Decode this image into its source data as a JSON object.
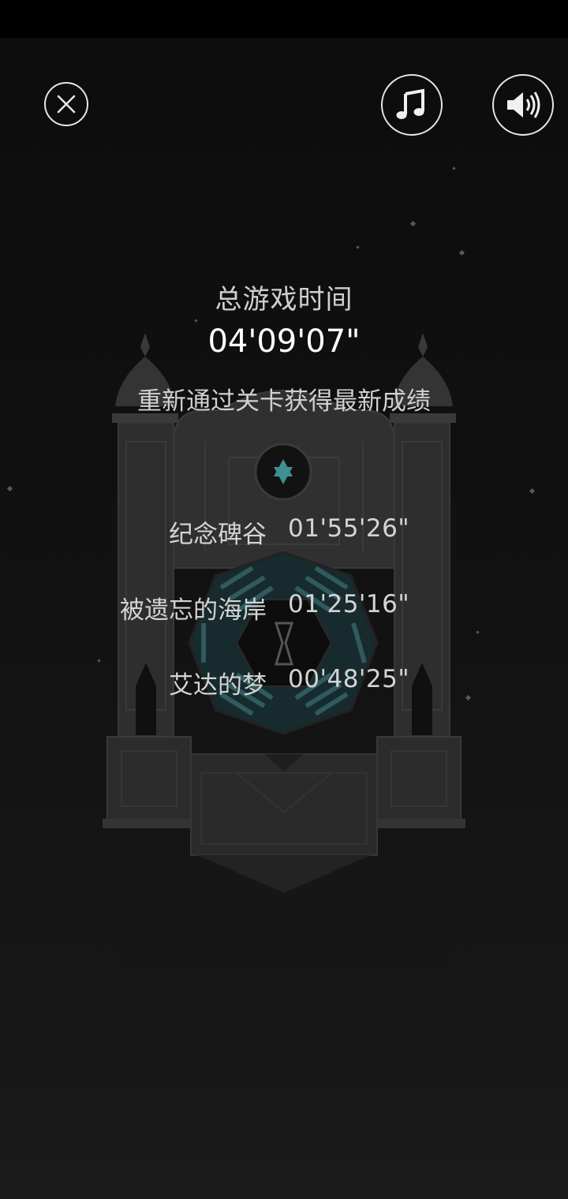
{
  "header": {
    "close_icon": "close-circle-icon",
    "music_icon": "music-note-icon",
    "sound_icon": "speaker-volume-icon"
  },
  "summary": {
    "title": "总游戏时间",
    "total_time": "04'09'07\"",
    "hint": "重新通过关卡获得最新成绩"
  },
  "chapters": [
    {
      "name": "纪念碑谷",
      "time": "01'55'26\""
    },
    {
      "name": "被遗忘的海岸",
      "time": "01'25'16\""
    },
    {
      "name": "艾达的梦",
      "time": "00'48'25\""
    }
  ],
  "colors": {
    "background": "#0c0c0c",
    "monument": "#2f2f2f",
    "accent": "#3f8f93",
    "button_outline": "#e6e6e6"
  }
}
